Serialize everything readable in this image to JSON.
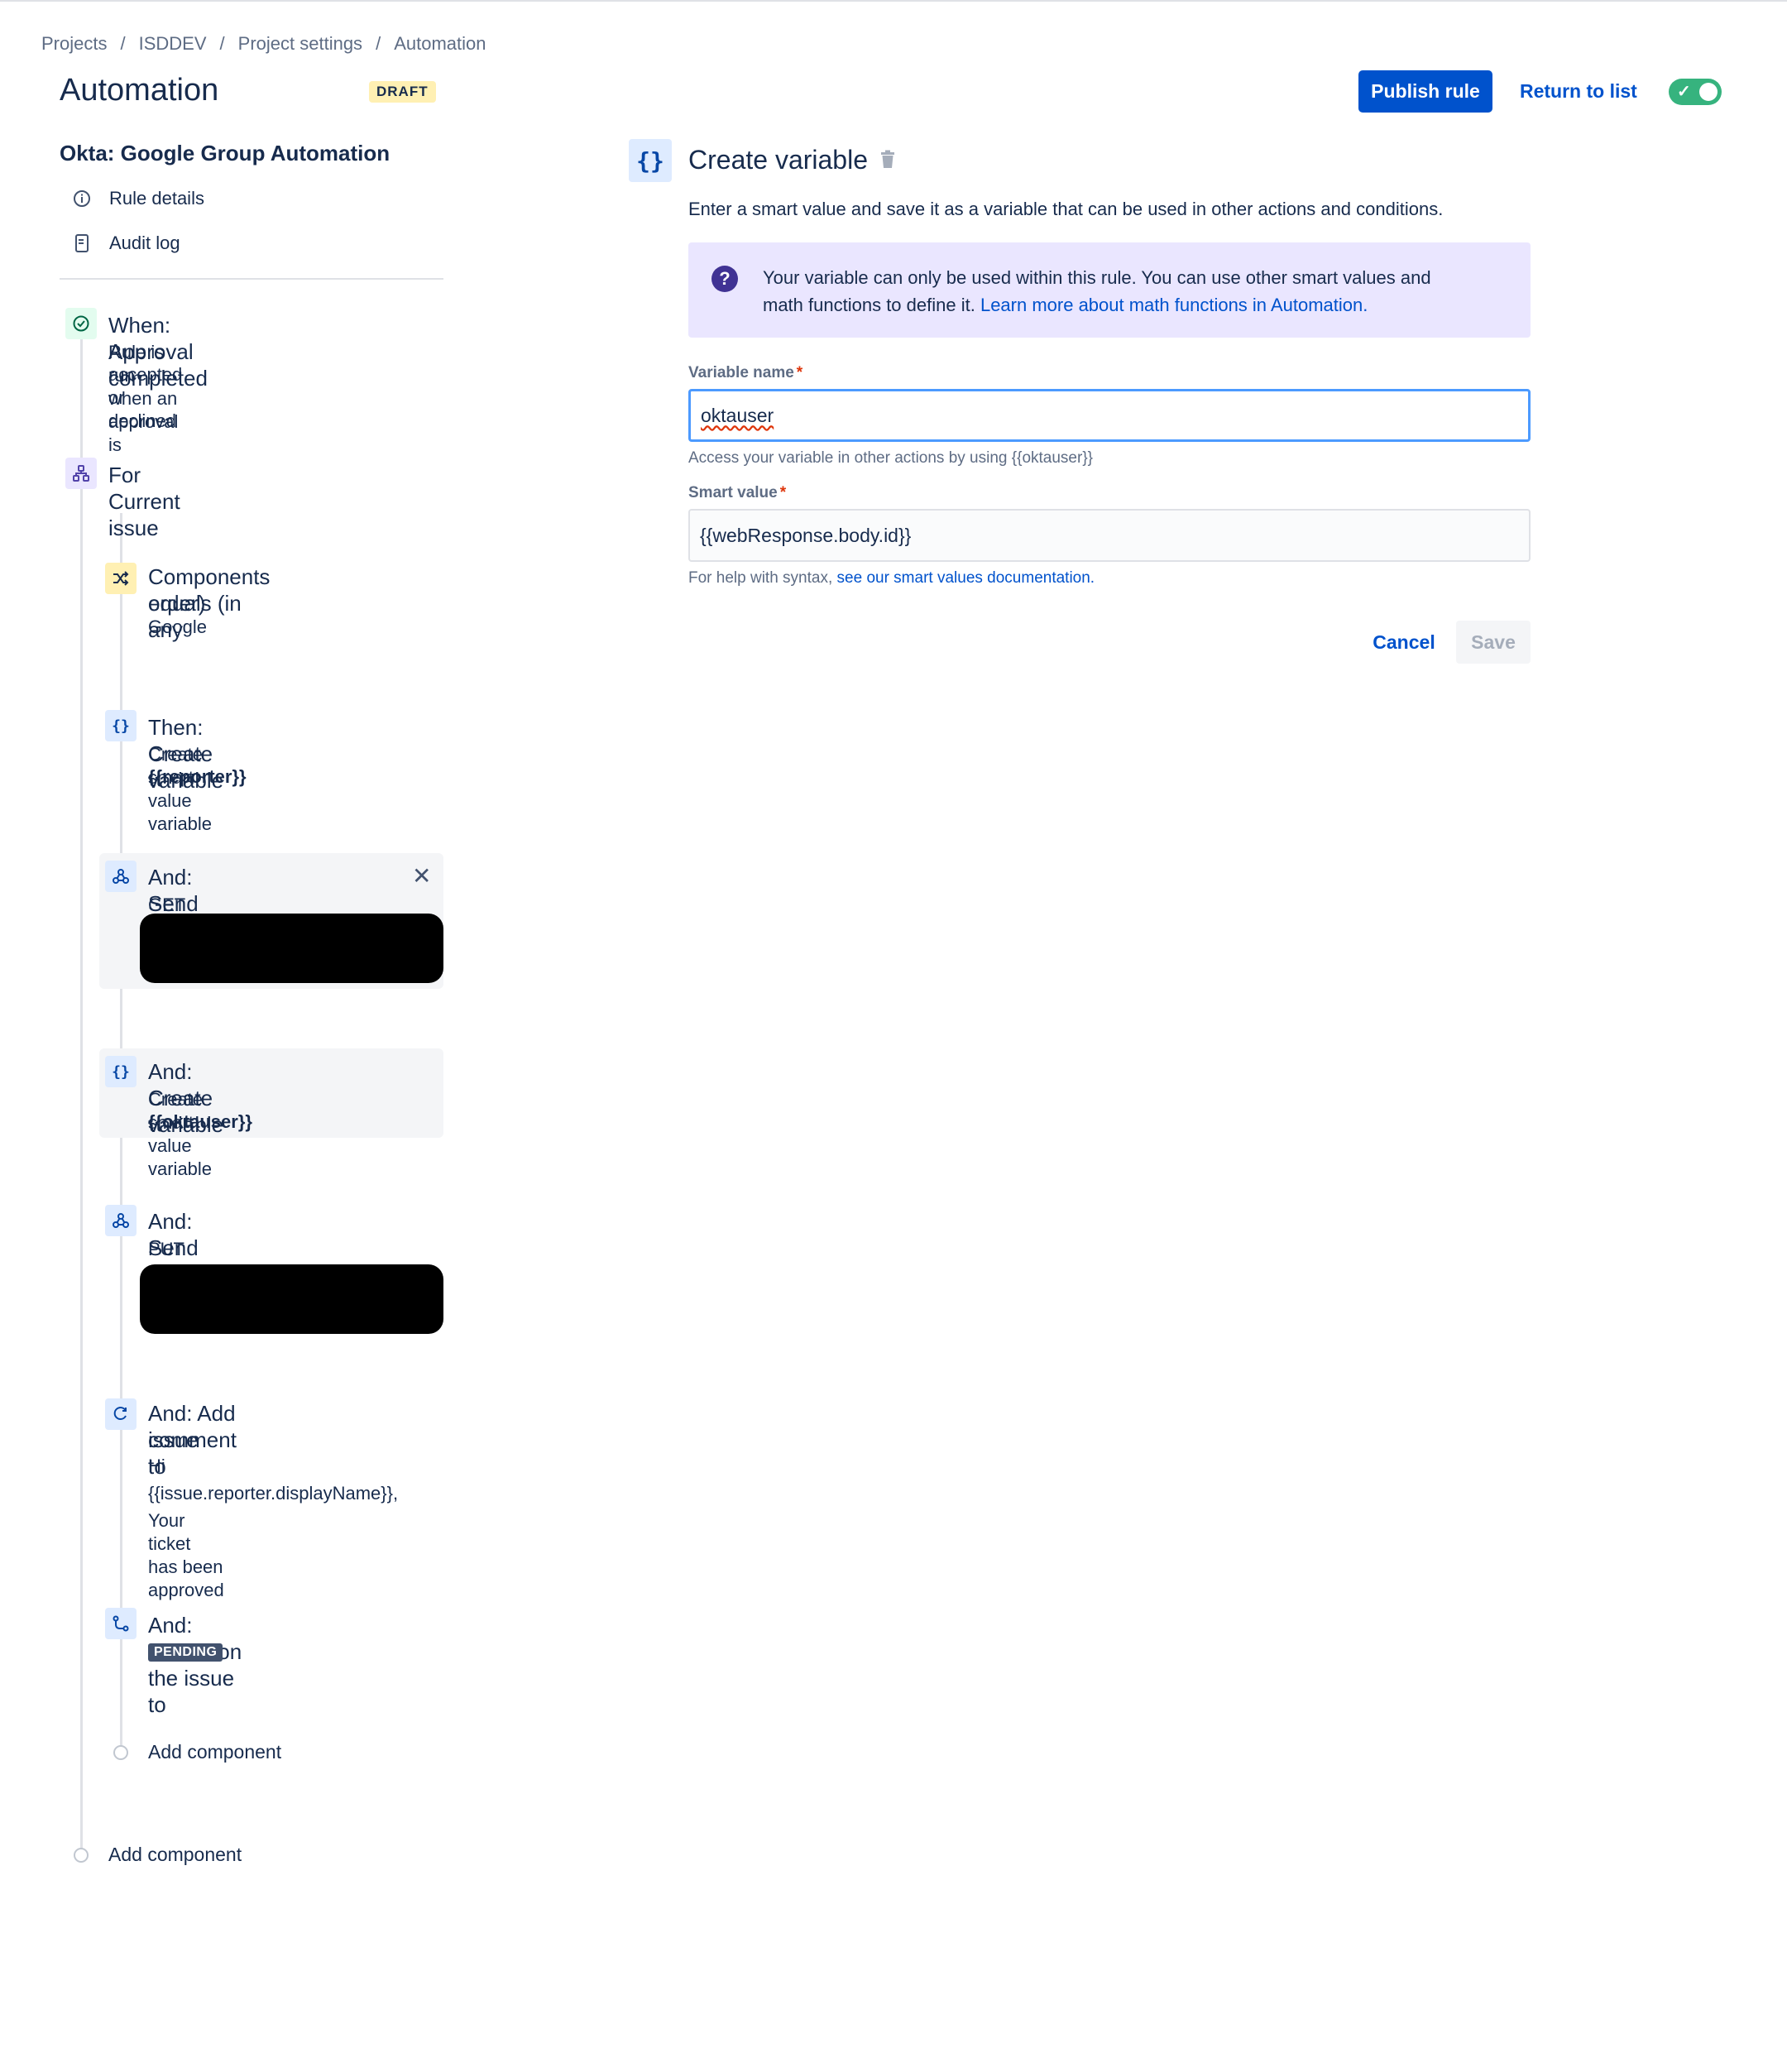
{
  "breadcrumb": [
    "Projects",
    "ISDDEV",
    "Project settings",
    "Automation"
  ],
  "header": {
    "title": "Automation",
    "badge": "DRAFT",
    "publish_label": "Publish rule",
    "return_label": "Return to list",
    "enabled": true
  },
  "sidebar": {
    "rule_name": "Okta: Google Group Automation",
    "links": [
      {
        "label": "Rule details",
        "icon": "info-icon"
      },
      {
        "label": "Audit log",
        "icon": "document-icon"
      }
    ],
    "trigger": {
      "title": "When: Approval completed",
      "subtitle_line1": "Rule is run when an approval is",
      "subtitle_line2": "accepted or declined"
    },
    "branch": {
      "title": "For Current issue"
    },
    "components": [
      {
        "title_line1": "Components equals (in any",
        "title_line2": "order)",
        "sub": "Google"
      },
      {
        "title": "Then: Create variable",
        "sub": "Create smart value variable",
        "bold": "{{reporter}}"
      },
      {
        "title": "And: Send web request",
        "sub": "GET"
      },
      {
        "title": "And: Create variable",
        "sub": "Create smart value variable",
        "bold": "{{oktauser}}"
      },
      {
        "title": "And: Send web request",
        "sub": "PUT"
      },
      {
        "title_line1": "And: Add comment to",
        "title_line2": "issue",
        "sub_line1": "Hi",
        "sub_line2": "{{issue.reporter.displayName}},",
        "sub_line3": "Your ticket has been approved"
      },
      {
        "title": "And: Transition the issue to",
        "badge": "PENDING"
      }
    ],
    "add_component_inner": "Add component",
    "add_component_outer": "Add component"
  },
  "panel": {
    "title": "Create variable",
    "description": "Enter a smart value and save it as a variable that can be used in other actions and conditions.",
    "info_line1": "Your variable can only be used within this rule. You can use other smart values and",
    "info_line2": "math functions to define it.",
    "info_link": "Learn more about math functions in Automation.",
    "variable_name_label": "Variable name",
    "variable_name_value": "oktauser",
    "variable_name_help": "Access your variable in other actions by using {{oktauser}}",
    "smart_value_label": "Smart value",
    "smart_value_value": "{{webResponse.body.id}}",
    "smart_value_help": "For help with syntax,",
    "smart_value_help_link": "see our smart values documentation.",
    "cancel_label": "Cancel",
    "save_label": "Save"
  },
  "colors": {
    "primary": "#0052CC",
    "toggle_on": "#36B37E",
    "info_bg": "#EAE6FF",
    "draft_bg": "#FFF0B3"
  }
}
